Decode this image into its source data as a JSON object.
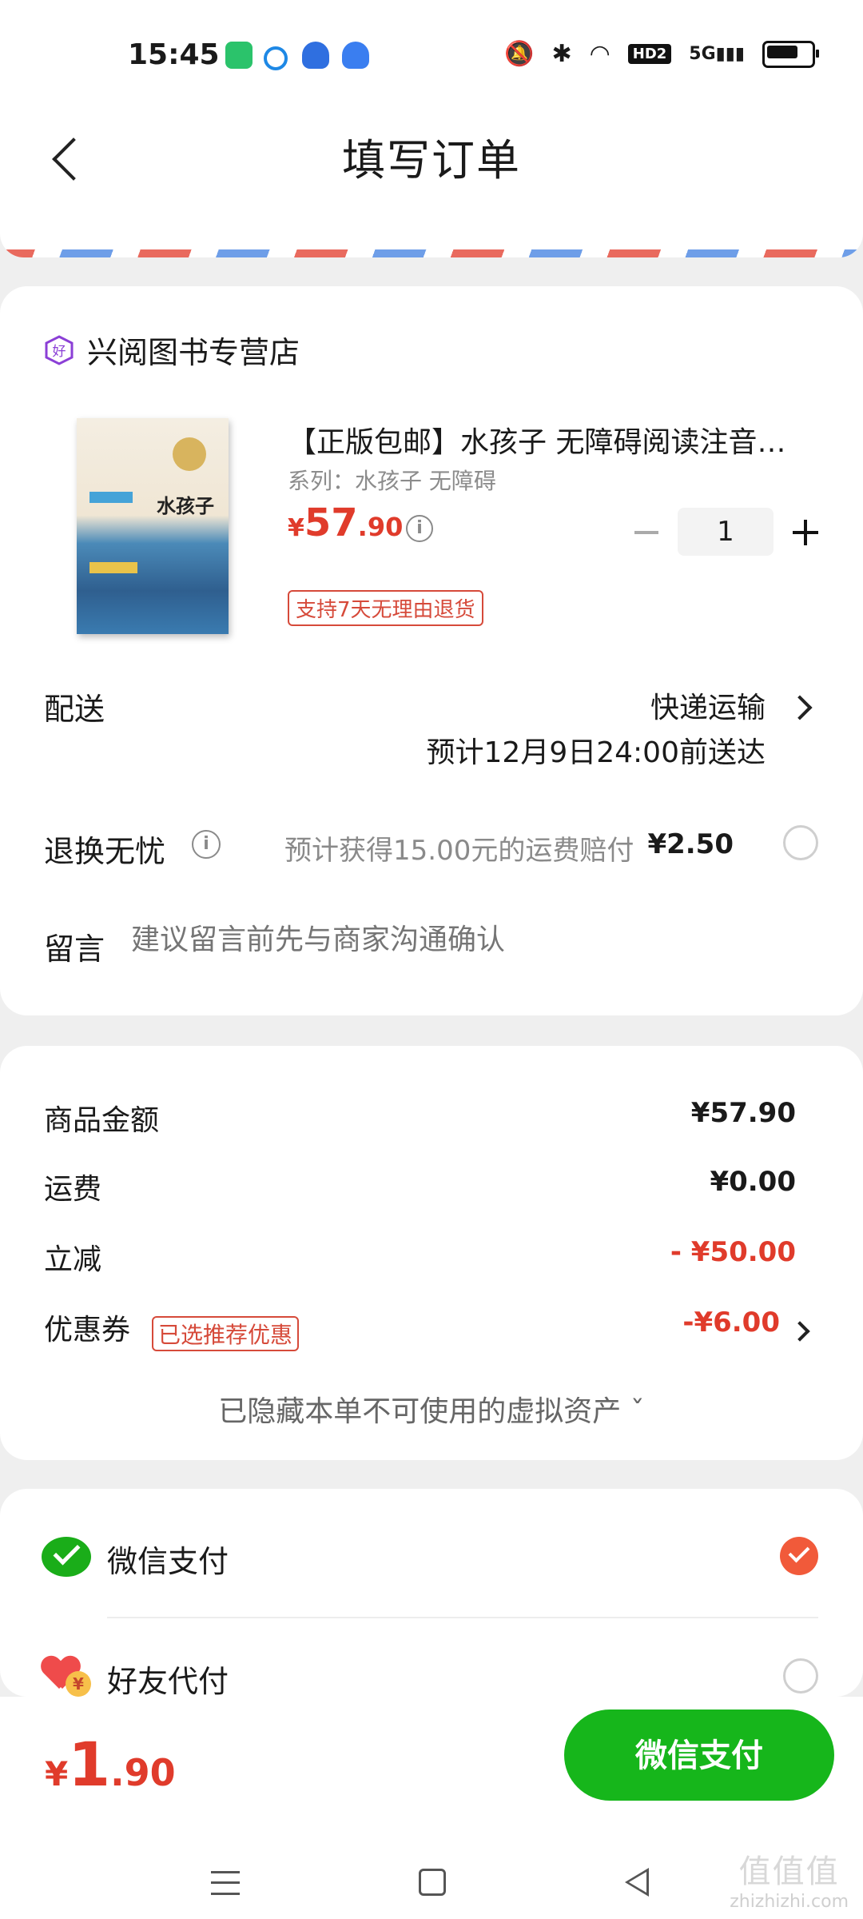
{
  "status_bar": {
    "time": "15:45",
    "hd": "HD2",
    "network": "5G"
  },
  "header": {
    "title": "填写订单"
  },
  "store": {
    "name": "兴阅图书专营店"
  },
  "product": {
    "title": "【正版包邮】水孩子 无障碍阅读注音…",
    "series": "系列：水孩子 无障碍",
    "price_currency": "¥",
    "price_int": "57",
    "price_dec": ".90",
    "quantity": "1",
    "return_badge": "支持7天无理由退货",
    "cover_title": "水孩子"
  },
  "delivery": {
    "label": "配送",
    "method": "快递运输",
    "eta": "预计12月9日24:00前送达"
  },
  "worry_free": {
    "label": "退换无忧",
    "desc": "预计获得15.00元的运费赔付",
    "price": "¥2.50"
  },
  "message": {
    "label": "留言",
    "placeholder": "建议留言前先与商家沟通确认"
  },
  "summary": {
    "goods_label": "商品金额",
    "goods_value": "¥57.90",
    "shipping_label": "运费",
    "shipping_value": "¥0.00",
    "discount_label": "立减",
    "discount_value": "- ¥50.00",
    "coupon_label": "优惠券",
    "coupon_badge": "已选推荐优惠",
    "coupon_value": "-¥6.00",
    "hidden_assets": "已隐藏本单不可使用的虚拟资产 ˇ"
  },
  "payment": {
    "wechat_label": "微信支付",
    "wechat_selected": true,
    "friend_label": "好友代付",
    "friend_selected": false
  },
  "footer": {
    "total_currency": "¥",
    "total_int": "1",
    "total_dec": ".90",
    "pay_button": "微信支付"
  },
  "watermark": {
    "big": "值值值",
    "site": "zhizhizhi.com"
  },
  "colors": {
    "accent_red": "#e03b2b",
    "wechat_green": "#16b61b"
  }
}
